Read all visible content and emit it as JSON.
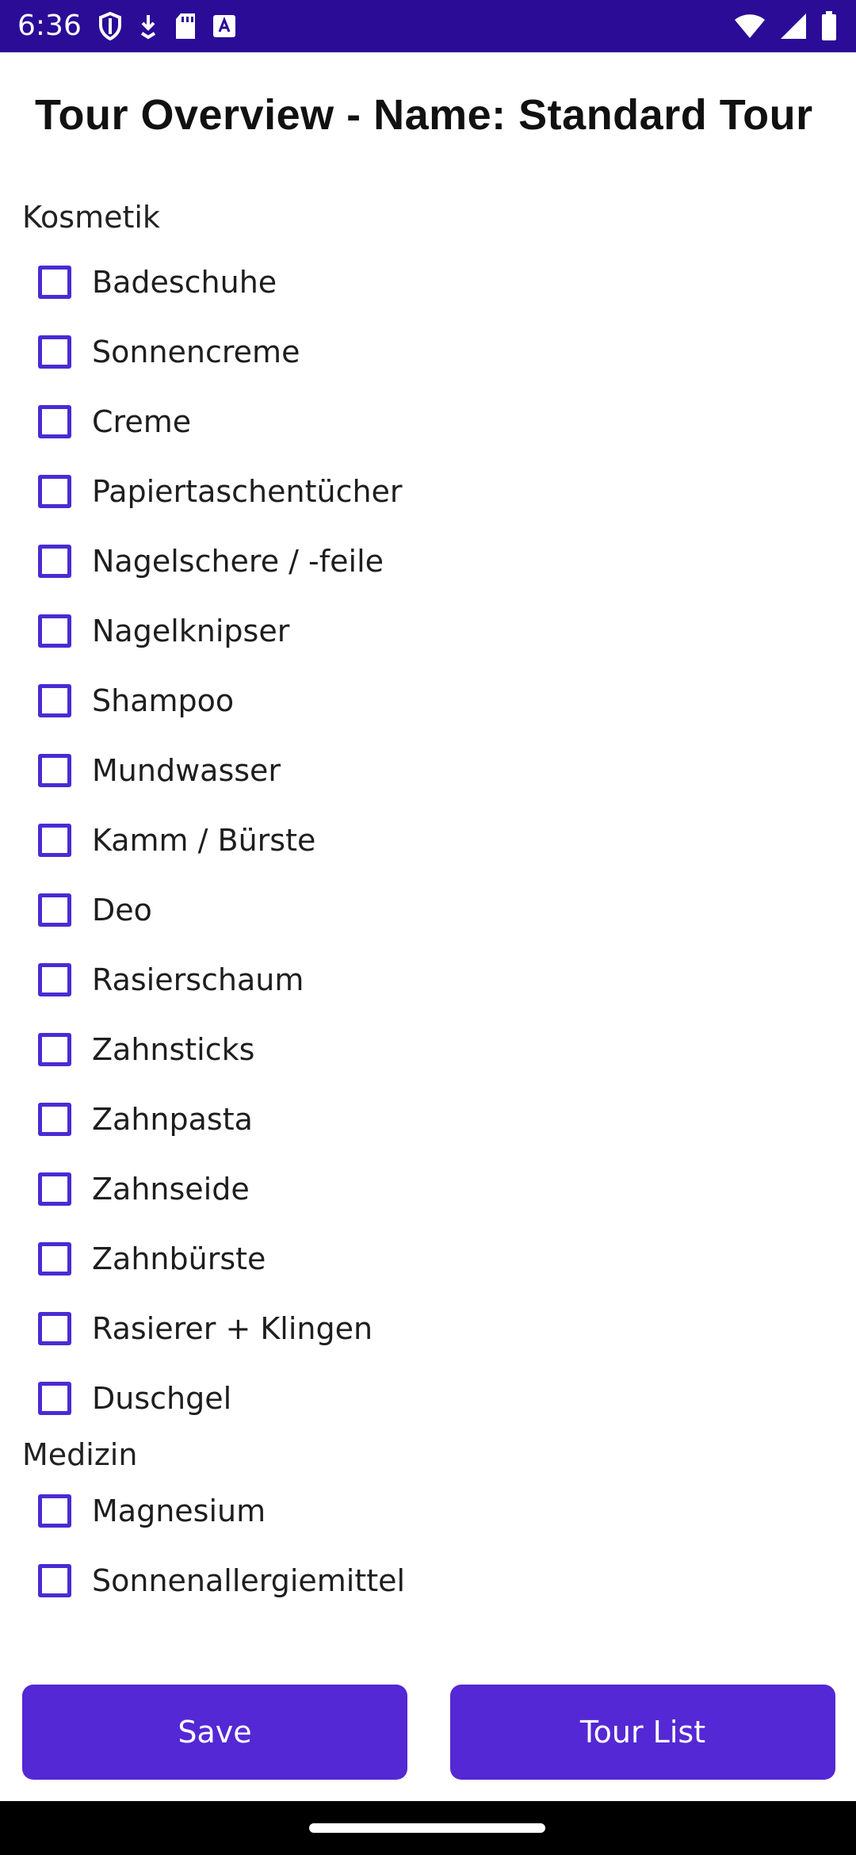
{
  "status_bar": {
    "time": "6:36",
    "left_icons": [
      "shield-icon",
      "download-icon",
      "sd-card-icon",
      "font-a-icon"
    ],
    "right_icons": [
      "wifi-icon",
      "signal-icon",
      "battery-icon"
    ]
  },
  "header": {
    "title": "Tour Overview - Name: Standard Tour"
  },
  "sections": [
    {
      "label": "Kosmetik",
      "items": [
        {
          "label": "Badeschuhe",
          "checked": false
        },
        {
          "label": "Sonnencreme",
          "checked": false
        },
        {
          "label": "Creme",
          "checked": false
        },
        {
          "label": "Papiertaschentücher",
          "checked": false
        },
        {
          "label": "Nagelschere / -feile",
          "checked": false
        },
        {
          "label": "Nagelknipser",
          "checked": false
        },
        {
          "label": "Shampoo",
          "checked": false
        },
        {
          "label": "Mundwasser",
          "checked": false
        },
        {
          "label": "Kamm / Bürste",
          "checked": false
        },
        {
          "label": "Deo",
          "checked": false
        },
        {
          "label": "Rasierschaum",
          "checked": false
        },
        {
          "label": "Zahnsticks",
          "checked": false
        },
        {
          "label": "Zahnpasta",
          "checked": false
        },
        {
          "label": "Zahnseide",
          "checked": false
        },
        {
          "label": "Zahnbürste",
          "checked": false
        },
        {
          "label": "Rasierer + Klingen",
          "checked": false
        },
        {
          "label": "Duschgel",
          "checked": false
        }
      ]
    },
    {
      "label": "Medizin",
      "items": [
        {
          "label": "Magnesium",
          "checked": false
        },
        {
          "label": "Sonnenallergiemittel",
          "checked": false
        }
      ]
    }
  ],
  "buttons": {
    "save_label": "Save",
    "tour_list_label": "Tour List"
  },
  "colors": {
    "status_bar": "#2a0c97",
    "accent": "#5428d4",
    "checkbox_border": "#4a2bd3"
  }
}
